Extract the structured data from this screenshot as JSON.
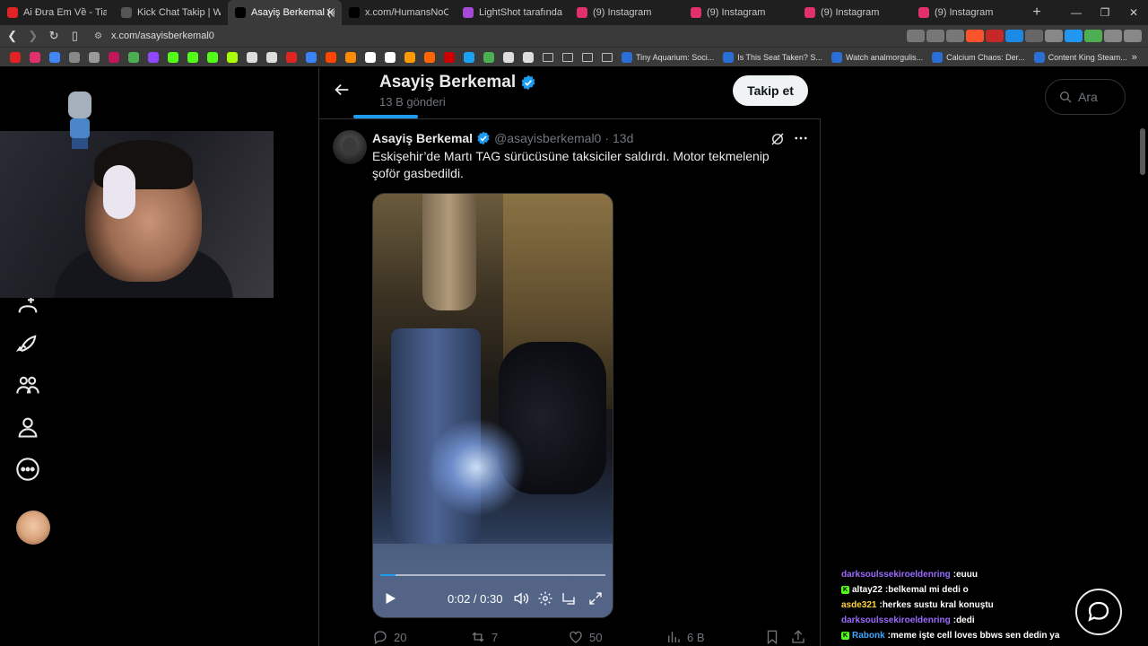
{
  "browser": {
    "tabs": [
      {
        "title": "Ai Đưa Em Về - Tia ft. Lê T",
        "favicon_color": "#e02424",
        "active": false
      },
      {
        "title": "Kick Chat Takip | Wich",
        "favicon_color": "#555555",
        "active": false
      },
      {
        "title": "Asayiş Berkemal (@as",
        "favicon_color": "#000000",
        "active": true
      },
      {
        "title": "x.com/HumansNoContext",
        "favicon_color": "#000000",
        "active": false
      },
      {
        "title": "LightShot tarafından Ekran",
        "favicon_color": "#a64bd8",
        "active": false
      },
      {
        "title": "(9) Instagram",
        "favicon_color": "#e1306c",
        "active": false
      },
      {
        "title": "(9) Instagram",
        "favicon_color": "#e1306c",
        "active": false
      },
      {
        "title": "(9) Instagram",
        "favicon_color": "#e1306c",
        "active": false
      },
      {
        "title": "(9) Instagram",
        "favicon_color": "#e1306c",
        "active": false
      }
    ],
    "url": "x.com/asayisberkemal0",
    "bookmarks": [
      {
        "title": "Tiny Aquarium: Soci..."
      },
      {
        "title": "Is This Seat Taken? S..."
      },
      {
        "title": "Watch analmorgulis..."
      },
      {
        "title": "Calcium Chaos: Der..."
      },
      {
        "title": "Content King Steam..."
      }
    ],
    "bookmark_icon_colors": [
      "#e02424",
      "#e1306c",
      "#4285f4",
      "#888888",
      "#999999",
      "#c2185b",
      "#4caf50",
      "#9146ff",
      "#53fc18",
      "#53fc18",
      "#53fc18",
      "#aaff00",
      "#dddddd",
      "#dddddd",
      "#e02424",
      "#3b82f6",
      "#ff4500",
      "#ff8c00",
      "#ffffff",
      "#ffffff",
      "#ff9900",
      "#ff6600",
      "#cc0000",
      "#1da1f2",
      "#4caf50",
      "#dddddd",
      "#dddddd"
    ]
  },
  "profile": {
    "name": "Asayiş Berkemal",
    "post_count": "13 B gönderi",
    "follow_label": "Takip et"
  },
  "post": {
    "author": "Asayiş Berkemal",
    "handle": "@asayisberkemal0",
    "separator": "·",
    "time": "13d",
    "text": "Eskişehir’de Martı TAG sürücüsüne taksiciler saldırdı. Motor tekmelenip şoför gasbedildi.",
    "video": {
      "time_label": "0:02 / 0:30",
      "progress": 0.067
    },
    "stats": {
      "replies": "20",
      "reposts": "7",
      "likes": "50",
      "views": "6 B"
    }
  },
  "search": {
    "placeholder": "Ara"
  },
  "chat": [
    {
      "user": "darksoulssekiroeldenring",
      "color": "#9b6bff",
      "badge": "",
      "message": "euuu"
    },
    {
      "user": "altay22",
      "color": "#ffffff",
      "badge": "K",
      "message": "belkemal mi dedi o"
    },
    {
      "user": "asde321",
      "color": "#ffd43b",
      "badge": "",
      "message": "herkes sustu kral konuştu"
    },
    {
      "user": "darksoulssekiroeldenring",
      "color": "#9b6bff",
      "badge": "",
      "message": "dedi"
    },
    {
      "user": "Rabonk",
      "color": "#3ba7ff",
      "badge": "K",
      "message": "meme işte cell loves bbws sen dedin ya"
    }
  ],
  "colors": {
    "accent": "#1d9bf0",
    "background": "#000000",
    "border": "#2f3336",
    "muted_text": "#71767b"
  }
}
